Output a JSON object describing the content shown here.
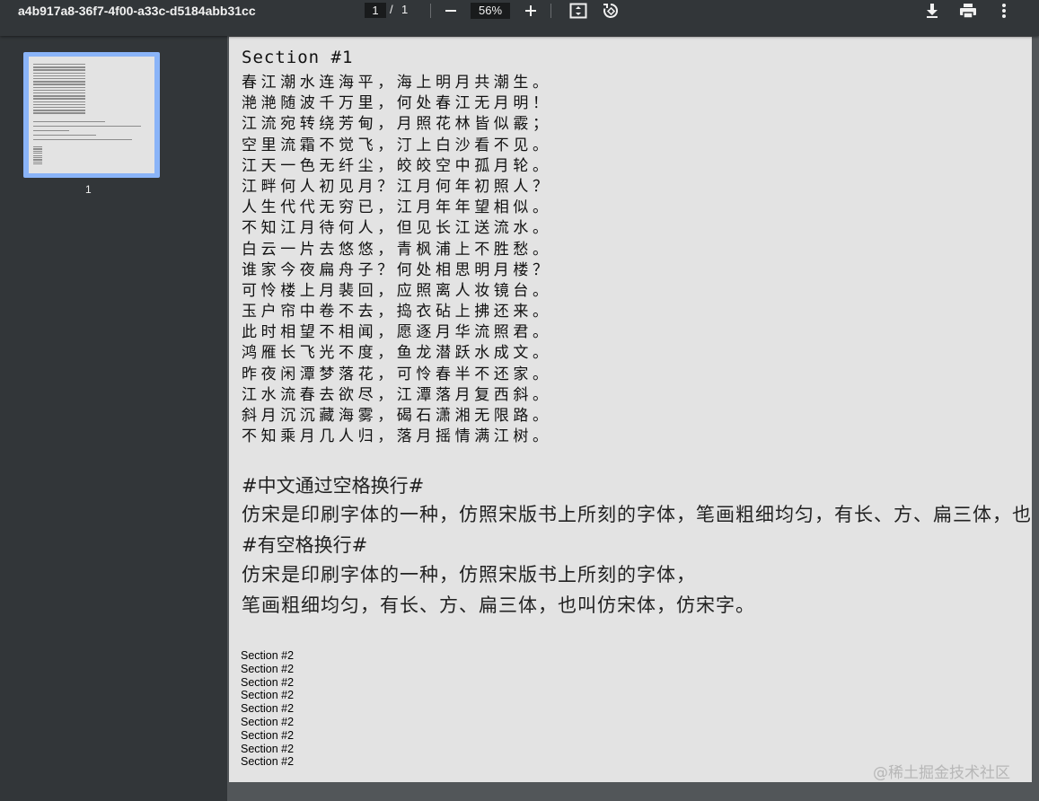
{
  "toolbar": {
    "title": "a4b917a8-36f7-4f00-a33c-d5184abb31cc",
    "current_page": "1",
    "page_separator": "/",
    "total_pages": "1",
    "zoom": "56%",
    "icons": [
      "minus-icon",
      "plus-icon",
      "fit-page-icon",
      "rotate-icon",
      "download-icon",
      "print-icon",
      "more-vert-icon"
    ]
  },
  "sidebar": {
    "thumbnail_label": "1"
  },
  "page": {
    "section1_title": "Section #1",
    "poem_lines": [
      "春江潮水连海平，海上明月共潮生。",
      "滟滟随波千万里，何处春江无月明！",
      "江流宛转绕芳甸，月照花林皆似霰；",
      "空里流霜不觉飞，汀上白沙看不见。",
      "江天一色无纤尘，皎皎空中孤月轮。",
      "江畔何人初见月？江月何年初照人？",
      "人生代代无穷已，江月年年望相似。",
      "不知江月待何人，但见长江送流水。",
      "白云一片去悠悠，青枫浦上不胜愁。",
      "谁家今夜扁舟子？何处相思明月楼？",
      "可怜楼上月裴回，应照离人妆镜台。",
      "玉户帘中卷不去，捣衣砧上拂还来。",
      "此时相望不相闻，愿逐月华流照君。",
      "鸿雁长飞光不度，鱼龙潜跃水成文。",
      "昨夜闲潭梦落花，可怜春半不还家。",
      "江水流春去欲尽，江潭落月复西斜。",
      "斜月沉沉藏海雾，碣石潇湘无限路。",
      "不知乘月几人归，落月摇情满江树。"
    ],
    "heading_no_space": "#中文通过空格换行#",
    "para_no_space": "仿宋是印刷字体的一种，仿照宋版书上所刻的字体，笔画粗细均匀，有长、方、扁三体，也",
    "heading_with_space": "#有空格换行#",
    "para_with_space_1": "仿宋是印刷字体的一种，仿照宋版书上所刻的字体，",
    "para_with_space_2": "笔画粗细均匀，有长、方、扁三体，也叫仿宋体，仿宋字。",
    "section2_lines": [
      "Section #2",
      "Section #2",
      "Section #2",
      "Section #2",
      "Section #2",
      "Section #2",
      "Section #2",
      "Section #2",
      "Section #2"
    ]
  },
  "watermark": "@稀土掘金技术社区",
  "colors": {
    "toolbar_bg": "#323639",
    "viewer_bg": "#525659",
    "page_bg": "#e3e3e3",
    "thumb_highlight": "#8ab4f8"
  }
}
